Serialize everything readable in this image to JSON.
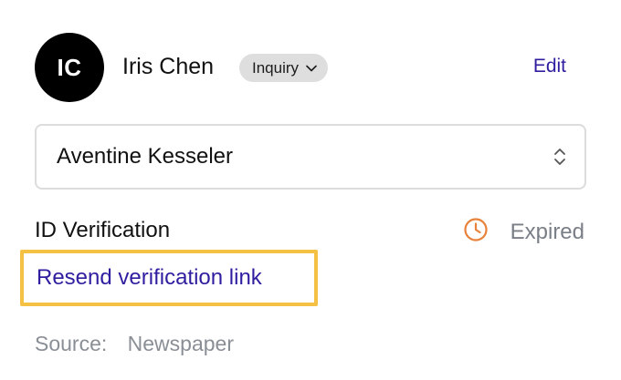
{
  "contact": {
    "initials": "IC",
    "name": "Iris Chen",
    "badge_label": "Inquiry",
    "edit_label": "Edit"
  },
  "selector": {
    "value": "Aventine Kesseler"
  },
  "verification": {
    "label": "ID Verification",
    "status": "Expired",
    "status_color": "#e8823a",
    "resend_label": "Resend verification link",
    "highlight_color": "#f5c144"
  },
  "source": {
    "label": "Source:",
    "value": "Newspaper"
  },
  "colors": {
    "link": "#2f1ea0",
    "muted": "#7a7f87"
  },
  "icons": {
    "badge": "chevron-down-icon",
    "selector": "chevron-up-down-icon",
    "status": "clock-icon"
  }
}
